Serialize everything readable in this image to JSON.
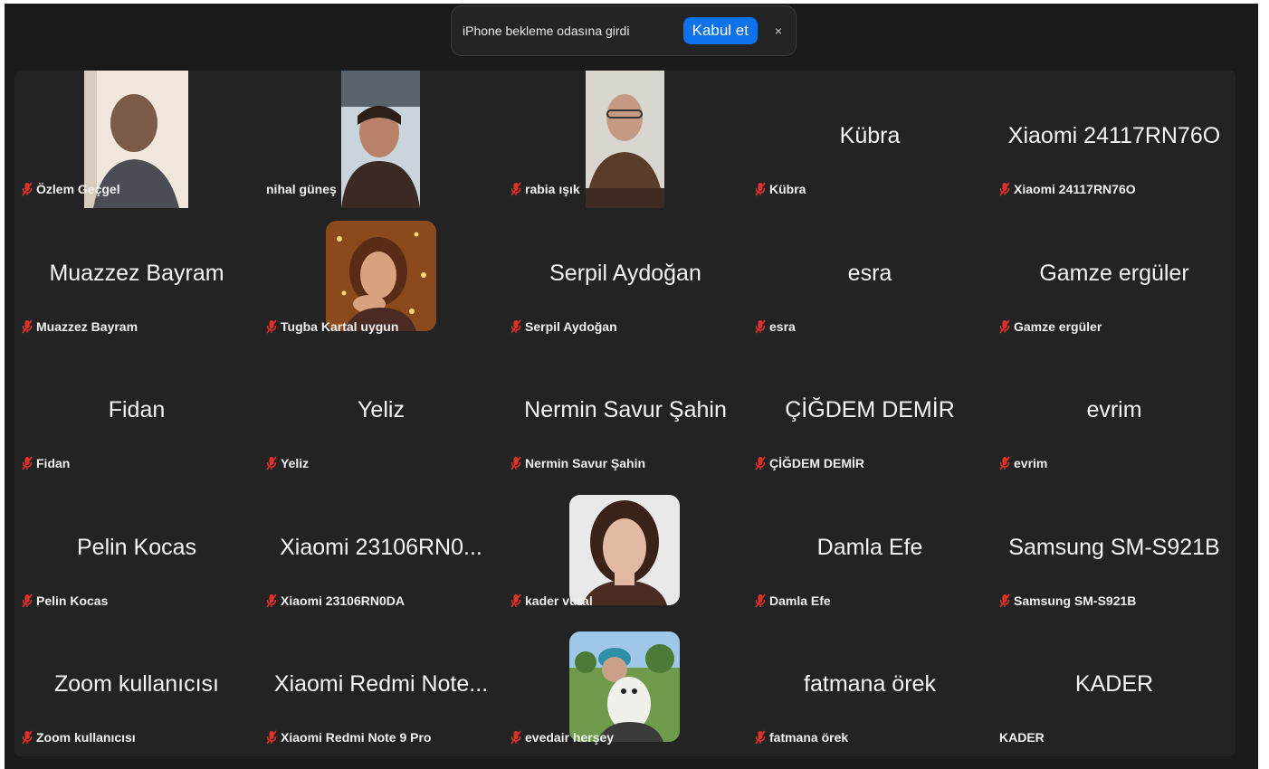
{
  "notification": {
    "message": "iPhone bekleme odasına girdi",
    "accept_label": "Kabul et",
    "close_glyph": "×"
  },
  "participants": [
    {
      "display": "",
      "label": "Özlem Geçgel",
      "video": true,
      "muted": true
    },
    {
      "display": "",
      "label": "nihal güneş",
      "video": true,
      "muted": false
    },
    {
      "display": "",
      "label": "rabia ışık",
      "video": true,
      "muted": true
    },
    {
      "display": "Kübra",
      "label": "Kübra",
      "video": false,
      "muted": true
    },
    {
      "display": "Xiaomi 24117RN76O",
      "label": "Xiaomi 24117RN76O",
      "video": false,
      "muted": true
    },
    {
      "display": "Muazzez Bayram",
      "label": "Muazzez Bayram",
      "video": false,
      "muted": true
    },
    {
      "display": "",
      "label": "Tugba Kartal uygun",
      "video": true,
      "muted": true
    },
    {
      "display": "Serpil Aydoğan",
      "label": "Serpil Aydoğan",
      "video": false,
      "muted": true
    },
    {
      "display": "esra",
      "label": "esra",
      "video": false,
      "muted": true
    },
    {
      "display": "Gamze ergüler",
      "label": "Gamze ergüler",
      "video": false,
      "muted": true
    },
    {
      "display": "Fidan",
      "label": "Fidan",
      "video": false,
      "muted": true
    },
    {
      "display": "Yeliz",
      "label": "Yeliz",
      "video": false,
      "muted": true
    },
    {
      "display": "Nermin Savur Şahin",
      "label": "Nermin Savur Şahin",
      "video": false,
      "muted": true
    },
    {
      "display": "ÇİĞDEM DEMİR",
      "label": "ÇİĞDEM DEMİR",
      "video": false,
      "muted": true
    },
    {
      "display": "evrim",
      "label": "evrim",
      "video": false,
      "muted": true
    },
    {
      "display": "Pelin Kocas",
      "label": "Pelin Kocas",
      "video": false,
      "muted": true
    },
    {
      "display": "Xiaomi 23106RN0...",
      "label": "Xiaomi 23106RN0DA",
      "video": false,
      "muted": true
    },
    {
      "display": "",
      "label": "kader vural",
      "video": true,
      "muted": true
    },
    {
      "display": "Damla Efe",
      "label": "Damla Efe",
      "video": false,
      "muted": true
    },
    {
      "display": "Samsung SM-S921B",
      "label": "Samsung SM-S921B",
      "video": false,
      "muted": true
    },
    {
      "display": "Zoom kullanıcısı",
      "label": "Zoom kullanıcısı",
      "video": false,
      "muted": true
    },
    {
      "display": "Xiaomi Redmi Note...",
      "label": "Xiaomi Redmi Note 9 Pro",
      "video": false,
      "muted": true
    },
    {
      "display": "",
      "label": "evedair herşey",
      "video": true,
      "muted": true
    },
    {
      "display": "fatmana örek",
      "label": "fatmana örek",
      "video": false,
      "muted": true
    },
    {
      "display": "KADER",
      "label": "KADER",
      "video": false,
      "muted": false
    }
  ],
  "colors": {
    "window_bg": "#1a1a1a",
    "tile_bg": "#232323",
    "muted_icon": "#e0302a",
    "accept_button": "#0e72ed"
  },
  "icons": {
    "muted": "microphone-muted-icon",
    "close": "close-icon"
  }
}
